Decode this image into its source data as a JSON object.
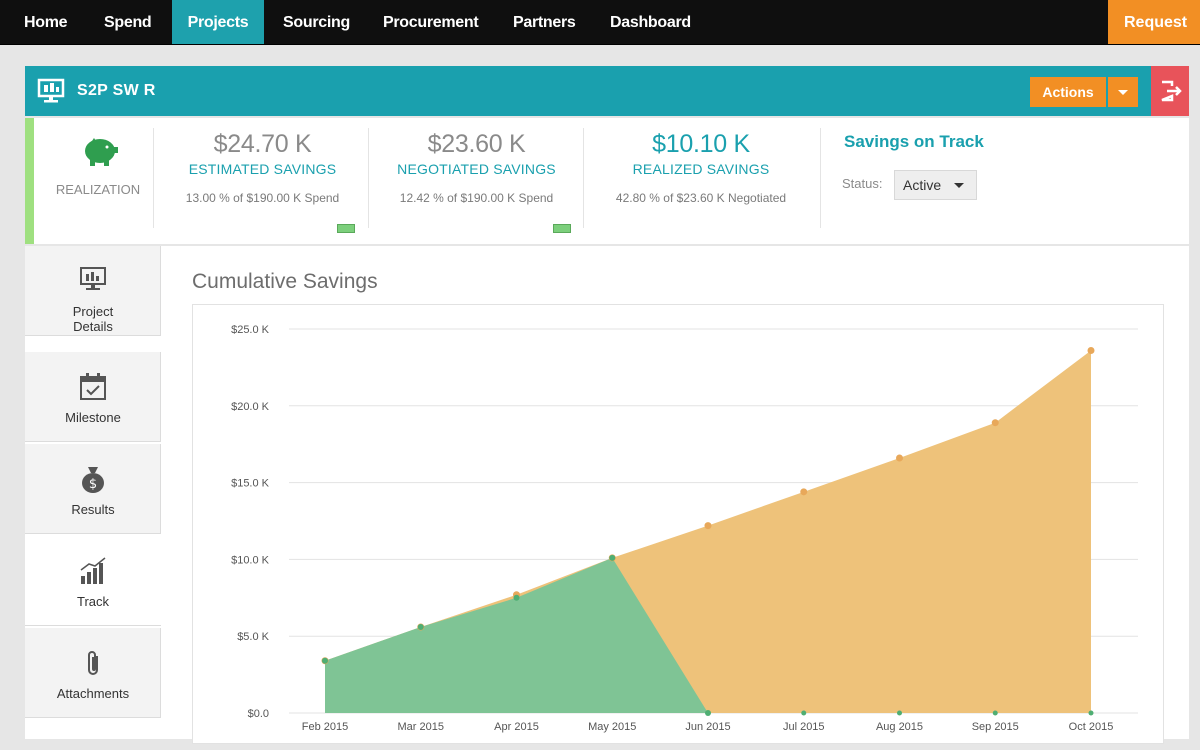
{
  "nav": {
    "items": [
      "Home",
      "Spend",
      "Projects",
      "Sourcing",
      "Procurement",
      "Partners",
      "Dashboard"
    ],
    "active": "Projects",
    "request_label": "Request"
  },
  "project": {
    "title": "S2P SW R",
    "actions_label": "Actions"
  },
  "savings": {
    "realization_label": "REALIZATION",
    "estimated": {
      "amount": "$24.70 K",
      "label": "ESTIMATED SAVINGS",
      "sub": "13.00 % of $190.00 K Spend"
    },
    "negotiated": {
      "amount": "$23.60 K",
      "label": "NEGOTIATED SAVINGS",
      "sub": "12.42 % of $190.00 K Spend"
    },
    "realized": {
      "amount": "$10.10 K",
      "label": "REALIZED SAVINGS",
      "sub": "42.80 % of $23.60 K Negotiated"
    },
    "on_track_title": "Savings on Track",
    "status_label": "Status:",
    "status_value": "Active"
  },
  "sidenav": {
    "tabs": [
      {
        "label": "Project\nDetails",
        "icon": "monitor-icon"
      },
      {
        "label": "Milestone",
        "icon": "calendar-icon"
      },
      {
        "label": "Results",
        "icon": "money-bag-icon"
      },
      {
        "label": "Track",
        "icon": "bar-chart-icon"
      },
      {
        "label": "Attachments",
        "icon": "paperclip-icon"
      }
    ],
    "active": "Track"
  },
  "colors": {
    "teal": "#1aa0ae",
    "orange": "#f28f24",
    "area_orange": "#eec27a",
    "area_green": "#7fc495",
    "red": "#e8535a"
  },
  "chart_data": {
    "type": "area",
    "title": "Cumulative Savings",
    "x": [
      "Feb 2015",
      "Mar 2015",
      "Apr 2015",
      "May 2015",
      "Jun 2015",
      "Jul 2015",
      "Aug 2015",
      "Sep 2015",
      "Oct 2015"
    ],
    "series": [
      {
        "values": [
          3.4,
          5.6,
          7.7,
          10.1,
          12.2,
          14.4,
          16.6,
          18.9,
          23.6
        ],
        "color": "#eec27a"
      },
      {
        "values": [
          3.4,
          5.6,
          7.5,
          10.1,
          0,
          null,
          null,
          null,
          null
        ],
        "color": "#7fc495"
      }
    ],
    "y_ticks": [
      "$0.0",
      "$5.0 K",
      "$10.0 K",
      "$15.0 K",
      "$20.0 K",
      "$25.0 K"
    ],
    "ylim": [
      0,
      25
    ],
    "grid": true
  }
}
